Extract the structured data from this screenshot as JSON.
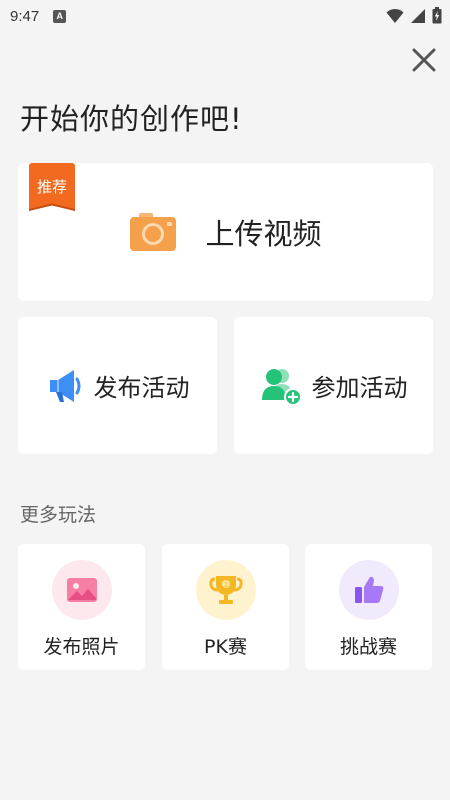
{
  "status_bar": {
    "time": "9:47",
    "notification_icon": "A"
  },
  "header": {
    "title": "开始你的创作吧!"
  },
  "upload_card": {
    "badge": "推荐",
    "label": "上传视频"
  },
  "actions": {
    "publish_label": "发布活动",
    "join_label": "参加活动"
  },
  "more": {
    "title": "更多玩法",
    "items": [
      {
        "label": "发布照片",
        "icon": "photo-icon"
      },
      {
        "label": "PK赛",
        "icon": "trophy-icon"
      },
      {
        "label": "挑战赛",
        "icon": "thumbs-up-icon"
      }
    ]
  },
  "colors": {
    "badge": "#f26a1f",
    "camera": "#f5a04a",
    "megaphone": "#3d8ef5",
    "join": "#25c27a",
    "photo_bg": "#fde8ee",
    "trophy_bg": "#fff3cf",
    "thumb_bg": "#f1eafd"
  }
}
